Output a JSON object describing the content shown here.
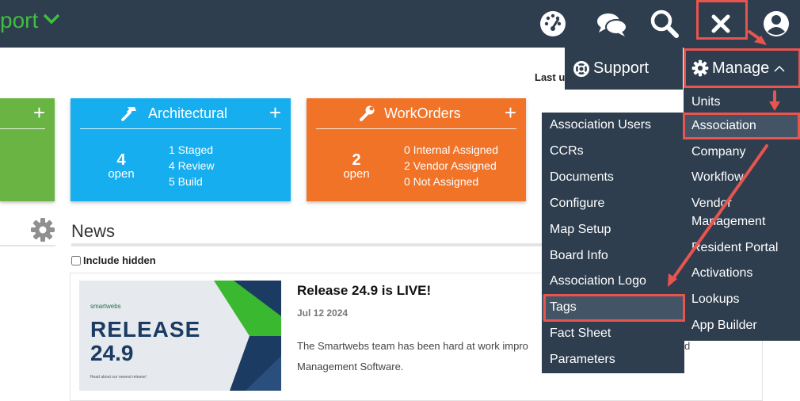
{
  "topbar": {
    "brand_text": "port",
    "icons": [
      "dashboard-icon",
      "chat-icon",
      "search-icon",
      "close-icon",
      "user-icon"
    ]
  },
  "tiles": {
    "architectural": {
      "title": "Architectural",
      "count": "4",
      "open_label": "open",
      "stats": [
        "1 Staged",
        "4 Review",
        "5 Build"
      ],
      "color": "#17aeef"
    },
    "workorders": {
      "title": "WorkOrders",
      "count": "2",
      "open_label": "open",
      "stats": [
        "0 Internal Assigned",
        "2 Vendor Assigned",
        "0 Not Assigned"
      ],
      "color": "#f07328"
    },
    "left_tile_color": "#6ab443"
  },
  "last_updated_label": "Last u",
  "news": {
    "title": "News",
    "include_hidden_label": "Include hidden",
    "include_hidden_checked": false,
    "item": {
      "title": "Release 24.9 is LIVE!",
      "date": "Jul 12 2024",
      "body_line1": "The Smartwebs team has been hard at work impro",
      "body_line1_tail": "d",
      "body_line2": "Management Software.",
      "banner": {
        "logo": "smartwebs",
        "line1": "RELEASE",
        "line2": "24.9",
        "caption": "Read about our newest release!"
      }
    }
  },
  "menus": {
    "support_label": "Support",
    "manage_label": "Manage",
    "manage_items": [
      "Units",
      "Association",
      "Company",
      "Workflow",
      "Vendor",
      "Management",
      "Resident Portal",
      "Activations",
      "Lookups",
      "App Builder"
    ],
    "association_items": [
      "Association Users",
      "CCRs",
      "Documents",
      "Configure",
      "Map Setup",
      "Board Info",
      "Association Logo",
      "Tags",
      "Fact Sheet",
      "Parameters"
    ]
  },
  "colors": {
    "nav_bg": "#2e3e4f",
    "menu_highlight": "#435466",
    "annotation_red": "#e8544e",
    "brand_green": "#3fbe3f"
  }
}
